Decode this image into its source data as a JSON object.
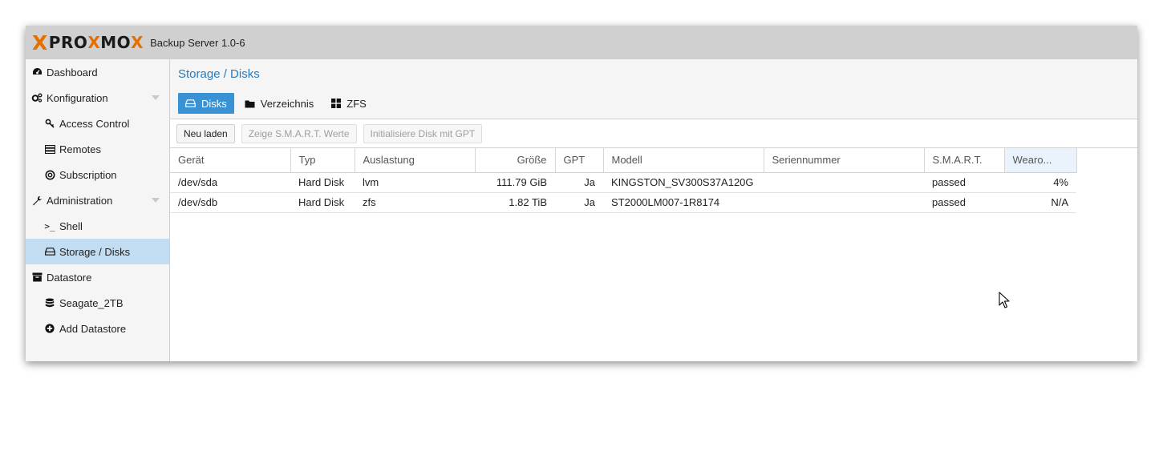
{
  "header": {
    "logo_text_a": "PRO",
    "logo_x": "X",
    "logo_text_b": "MO",
    "logo_x2": "X",
    "version": "Backup Server 1.0-6"
  },
  "sidebar": {
    "items": [
      {
        "label": "Dashboard",
        "icon": "dashboard-icon"
      },
      {
        "label": "Konfiguration",
        "icon": "cogs-icon"
      },
      {
        "label": "Access Control",
        "icon": "key-icon"
      },
      {
        "label": "Remotes",
        "icon": "server-icon"
      },
      {
        "label": "Subscription",
        "icon": "support-icon"
      },
      {
        "label": "Administration",
        "icon": "wrench-icon"
      },
      {
        "label": "Shell",
        "icon": "terminal-icon"
      },
      {
        "label": "Storage / Disks",
        "icon": "hdd-icon"
      },
      {
        "label": "Datastore",
        "icon": "archive-icon"
      },
      {
        "label": "Seagate_2TB",
        "icon": "database-icon"
      },
      {
        "label": "Add Datastore",
        "icon": "plus-circle-icon"
      }
    ]
  },
  "main": {
    "title": "Storage / Disks",
    "tabs": [
      {
        "label": "Disks",
        "icon": "hdd-icon"
      },
      {
        "label": "Verzeichnis",
        "icon": "folder-icon"
      },
      {
        "label": "ZFS",
        "icon": "th-large-icon"
      }
    ],
    "toolbar": {
      "reload": "Neu laden",
      "smart": "Zeige S.M.A.R.T. Werte",
      "init_gpt": "Initialisiere Disk mit GPT"
    },
    "table": {
      "columns": [
        "Gerät",
        "Typ",
        "Auslastung",
        "Größe",
        "GPT",
        "Modell",
        "Seriennummer",
        "S.M.A.R.T.",
        "Wearo..."
      ],
      "rows": [
        [
          "/dev/sda",
          "Hard Disk",
          "lvm",
          "111.79 GiB",
          "Ja",
          "KINGSTON_SV300S37A120G",
          "",
          "passed",
          "4%"
        ],
        [
          "/dev/sdb",
          "Hard Disk",
          "zfs",
          "1.82 TiB",
          "Ja",
          "ST2000LM007-1R8174",
          "",
          "passed",
          "N/A"
        ]
      ]
    }
  }
}
